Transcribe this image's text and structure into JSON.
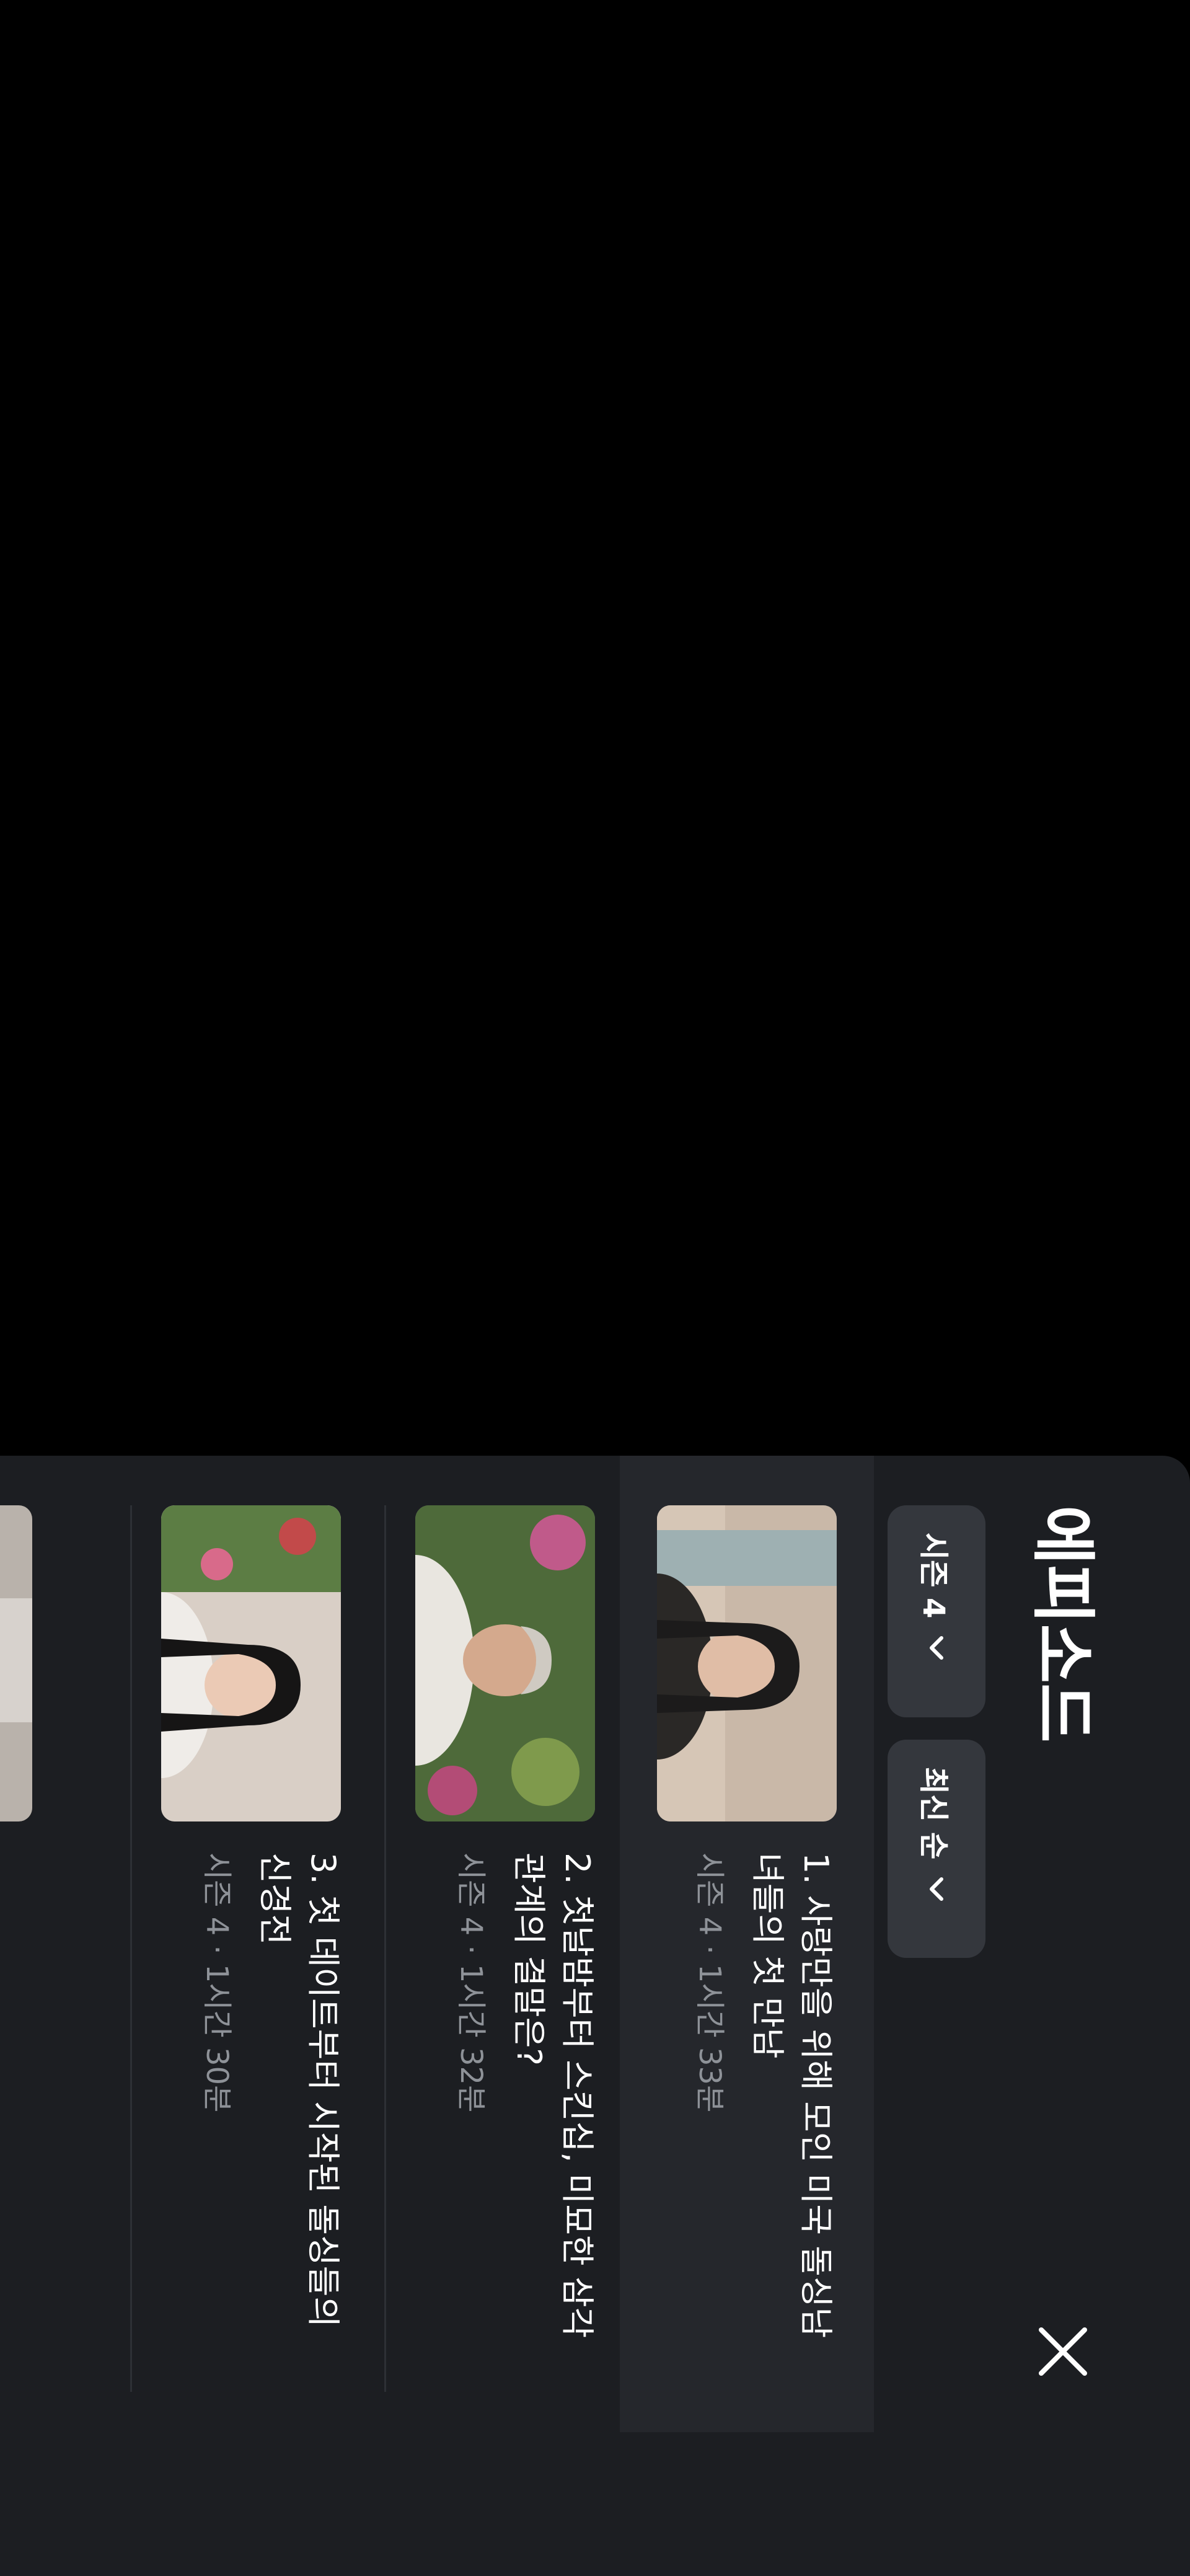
{
  "sheet": {
    "title": "에피소드",
    "close_icon": "close-icon"
  },
  "filters": {
    "season_label": "시즌 4",
    "sort_label": "최신 순",
    "chevron_icon": "chevron-down-icon"
  },
  "episodes": [
    {
      "title": "1. 사랑만을 위해 모인 미국 돌싱남녀들의 첫 만남",
      "meta": "시즌 4 · 1시간 33분",
      "selected": true
    },
    {
      "title": "2. 첫날밤부터 스킨십, 미묘한 삼각관계의 결말은?",
      "meta": "시즌 4 · 1시간 32분",
      "selected": false
    },
    {
      "title": "3. 첫 데이트부터 시작된 돌싱들의 신경전",
      "meta": "시즌 4 · 1시간 30분",
      "selected": false
    }
  ],
  "colors": {
    "sheet_background": "#1c1e22",
    "selected_row": "#25272c",
    "chip_background": "#34373d",
    "text_primary": "#ffffff",
    "text_secondary": "#8e9298"
  }
}
